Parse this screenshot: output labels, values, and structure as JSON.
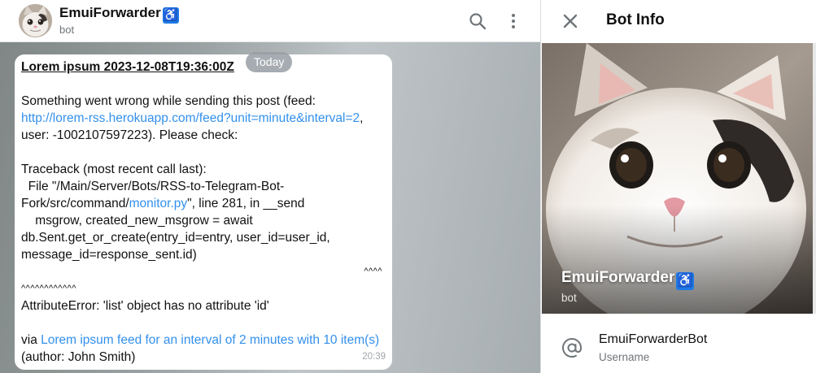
{
  "chat": {
    "title": "EmuiForwarder",
    "title_emoji": "♿",
    "subtitle": "bot"
  },
  "date_badge": "Today",
  "message": {
    "title": "Lorem ipsum 2023-12-08T19:36:00Z",
    "line1": "Something went wrong while sending this post (feed: ",
    "feed_link": "http://lorem-rss.herokuapp.com/feed?unit=minute&interval=2",
    "line1_tail": ",",
    "line2": "user: -1002107597223). Please check:",
    "tb1": "Traceback (most recent call last):",
    "tb2": "  File \"/Main/Server/Bots/RSS-to-Telegram-Bot-",
    "tb3_a": "Fork/src/command/",
    "tb3_link": "monitor.py",
    "tb3_b": "\", line 281, in __send",
    "tb4": "    msgrow, created_new_msgrow = await",
    "tb5": "db.Sent.get_or_create(entry_id=entry, user_id=user_id,",
    "tb6": "message_id=response_sent.id)",
    "caret_right": "^^^^",
    "caret_left": "^^^^^^^^^^^^",
    "error": "AttributeError: 'list' object has no attribute 'id'",
    "via": "via ",
    "via_link": "Lorem ipsum feed for an interval of 2 minutes with 10 item(s)",
    "author": " (author: John Smith)",
    "time": "20:39"
  },
  "panel": {
    "title": "Bot Info",
    "name": "EmuiForwarder",
    "name_emoji": "♿",
    "subtitle": "bot",
    "username": "EmuiForwarderBot",
    "username_label": "Username"
  },
  "icons": {
    "search": "search-icon",
    "menu": "more-vertical-icon",
    "close": "close-icon",
    "username": "at-icon"
  }
}
